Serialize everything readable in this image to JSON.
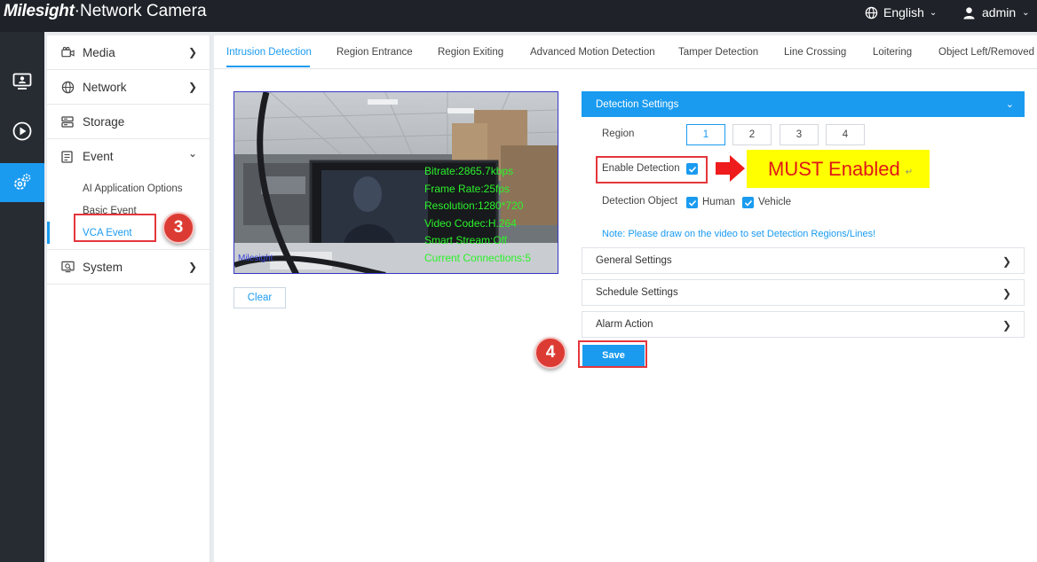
{
  "header": {
    "brand_logo": "Milesight",
    "brand_title": "·Network Camera",
    "language": "English",
    "user": "admin"
  },
  "rail": {
    "items": [
      "live-view-icon",
      "playback-icon",
      "settings-icon"
    ],
    "active": "settings-icon"
  },
  "sidebar": {
    "items": [
      {
        "label": "Media"
      },
      {
        "label": "Network"
      },
      {
        "label": "Storage"
      },
      {
        "label": "Event"
      },
      {
        "label": "System"
      }
    ],
    "event_subitems": [
      {
        "label": "AI Application Options"
      },
      {
        "label": "Basic Event"
      },
      {
        "label": "VCA Event"
      }
    ],
    "active_subitem": "VCA Event"
  },
  "tabs": [
    {
      "label": "Intrusion Detection"
    },
    {
      "label": "Region Entrance"
    },
    {
      "label": "Region Exiting"
    },
    {
      "label": "Advanced Motion Detection"
    },
    {
      "label": "Tamper Detection"
    },
    {
      "label": "Line Crossing"
    },
    {
      "label": "Loitering"
    },
    {
      "label": "Object Left/Removed"
    }
  ],
  "active_tab": "Intrusion Detection",
  "video": {
    "osd_lines": [
      "Bitrate:2865.7kbps",
      "Frame Rate:25fps",
      "Resolution:1280*720",
      "Video Codec:H.264",
      "Smart Stream:Off",
      "Current Connections:5"
    ],
    "camera_label": "Milesight",
    "clear_label": "Clear"
  },
  "detection_settings": {
    "title": "Detection Settings",
    "region_label": "Region",
    "regions": [
      "1",
      "2",
      "3",
      "4"
    ],
    "selected_region": "1",
    "enable_label": "Enable Detection",
    "enable_checked": true,
    "object_label": "Detection Object",
    "objects": [
      {
        "label": "Human",
        "checked": true
      },
      {
        "label": "Vehicle",
        "checked": true
      }
    ],
    "note": "Note: Please draw on the video to set Detection Regions/Lines!"
  },
  "sections": [
    {
      "label": "General Settings"
    },
    {
      "label": "Schedule Settings"
    },
    {
      "label": "Alarm Action"
    }
  ],
  "save_label": "Save",
  "annotations": {
    "must_text": "MUST Enabled",
    "return_mark": "↵",
    "step3": "3",
    "step4": "4"
  },
  "colors": {
    "accent": "#1a9bf0",
    "topbar": "#1f2329",
    "rail": "#272c33",
    "highlight_red": "#e4363c",
    "osd_green": "#2cf22c",
    "callout_yellow": "#ffff00"
  }
}
